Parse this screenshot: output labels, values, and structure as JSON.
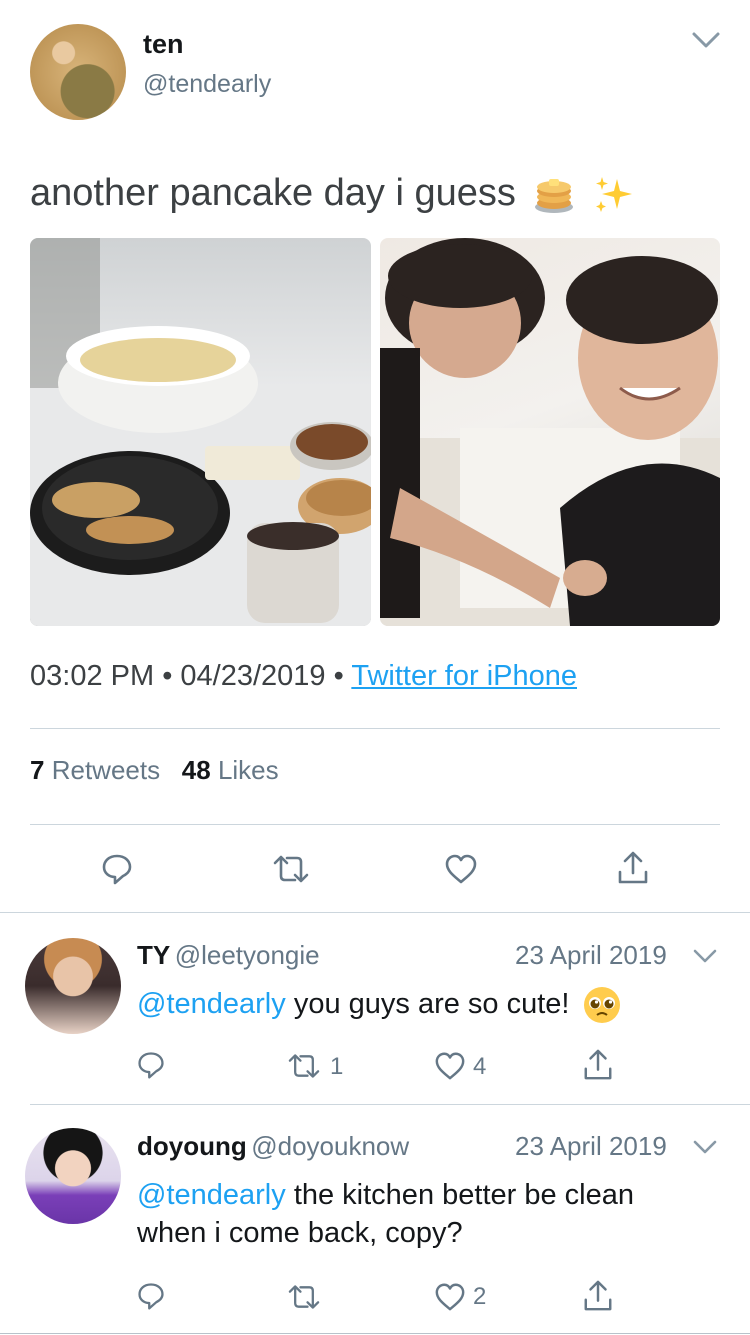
{
  "tweet": {
    "author_name": "ten",
    "author_handle": "@tendearly",
    "text": "another pancake day i guess",
    "emojis": [
      "pancakes",
      "sparkles"
    ],
    "time": "03:02 PM",
    "date": "04/23/2019",
    "separator": "•",
    "source": "Twitter for iPhone",
    "retweets_count": "7",
    "retweets_label": "Retweets",
    "likes_count": "48",
    "likes_label": "Likes"
  },
  "replies": [
    {
      "name": "TY",
      "handle": "@leetyongie",
      "date": "23 April 2019",
      "mention": "@tendearly",
      "text": "you guys are so cute!",
      "emoji": "pleading-face",
      "retweet_count": "1",
      "like_count": "4"
    },
    {
      "name": "doyoung",
      "handle": "@doyouknow",
      "date": "23 April 2019",
      "mention": "@tendearly",
      "text_line1": "the kitchen better be clean",
      "text_line2": "when i come back, copy?",
      "like_count": "2"
    }
  ],
  "colors": {
    "accent": "#1da1f2",
    "icon": "#657786",
    "divider": "#ccd6dd"
  }
}
